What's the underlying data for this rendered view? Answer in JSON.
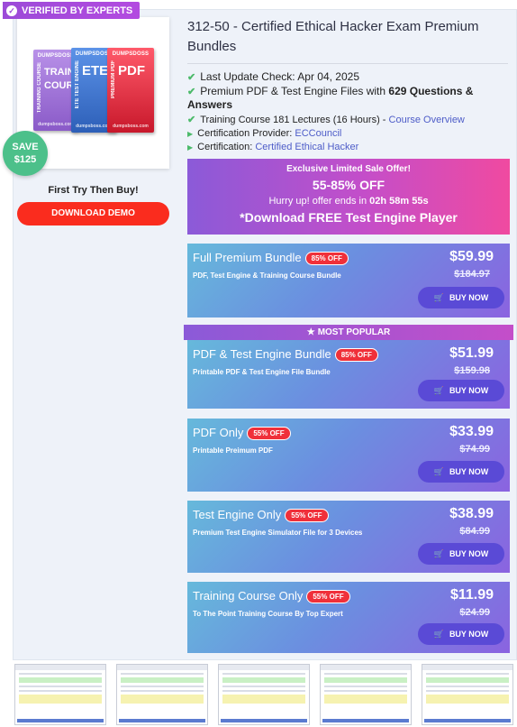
{
  "badge": {
    "verified": "VERIFIED BY EXPERTS"
  },
  "product_image": {
    "box1": {
      "brand": "DUMPSDOSS",
      "vertical": "TRAINING COURSE",
      "big": "TRAIN COUR",
      "foot": "dumpsboss.com"
    },
    "box2": {
      "brand": "DUMPSDOSS",
      "vertical": "ETE TEST ENGINE",
      "big": "ETE",
      "foot": "dumpsboss.com"
    },
    "box3": {
      "brand": "DUMPSDOSS",
      "vertical": "PREMIUM PDF",
      "big": "PDF",
      "foot": "dumpsboss.com"
    }
  },
  "save": {
    "label": "SAVE",
    "amount": "$125"
  },
  "left": {
    "first_try": "First Try Then Buy!",
    "download_demo": "DOWNLOAD DEMO"
  },
  "title": "312-50 - Certified Ethical Hacker Exam Premium Bundles",
  "info": {
    "last_update": "Last Update Check: Apr 04, 2025",
    "files_prefix": "Premium PDF & Test Engine Files with ",
    "files_bold": "629 Questions &",
    "files_bold2": "Answers",
    "training": "Training Course 181 Lectures (16 Hours) - ",
    "course_overview": "Course Overview",
    "provider_label": "Certification Provider: ",
    "provider": "ECCouncil",
    "certification_label": "Certification: ",
    "certification": "Certified Ethical Hacker"
  },
  "sale": {
    "line1": "Exclusive Limited Sale Offer!",
    "line2": "55-85% OFF",
    "line3_prefix": "Hurry up! offer ends in ",
    "countdown": "02h 58m 55s",
    "line4": "*Download FREE Test Engine Player"
  },
  "popular": "MOST POPULAR",
  "bundles": [
    {
      "name": "Full Premium Bundle",
      "off": "85% OFF",
      "desc": "PDF, Test Engine & Training Course Bundle",
      "price": "$59.99",
      "old": "$184.97",
      "buy": "BUY NOW"
    },
    {
      "name": "PDF & Test Engine Bundle",
      "off": "85% OFF",
      "desc": "Printable PDF & Test Engine File Bundle",
      "price": "$51.99",
      "old": "$159.98",
      "buy": "BUY NOW"
    },
    {
      "name": "PDF Only",
      "off": "55% OFF",
      "desc": "Printable Preimum PDF",
      "price": "$33.99",
      "old": "$74.99",
      "buy": "BUY NOW"
    },
    {
      "name": "Test Engine Only",
      "off": "55% OFF",
      "desc": "Premium Test Engine Simulator File for 3 Devices",
      "price": "$38.99",
      "old": "$84.99",
      "buy": "BUY NOW"
    },
    {
      "name": "Training Course Only",
      "off": "55% OFF",
      "desc": "To The Point Training Course By Top Expert",
      "price": "$11.99",
      "old": "$24.99",
      "buy": "BUY NOW"
    }
  ],
  "colors": {
    "accent_purple": "#8b5ad8",
    "demo_red": "#fa2c1e",
    "check_green": "#4cba6a",
    "save_green": "#4cc08a",
    "link_blue": "#4d5cc8"
  }
}
